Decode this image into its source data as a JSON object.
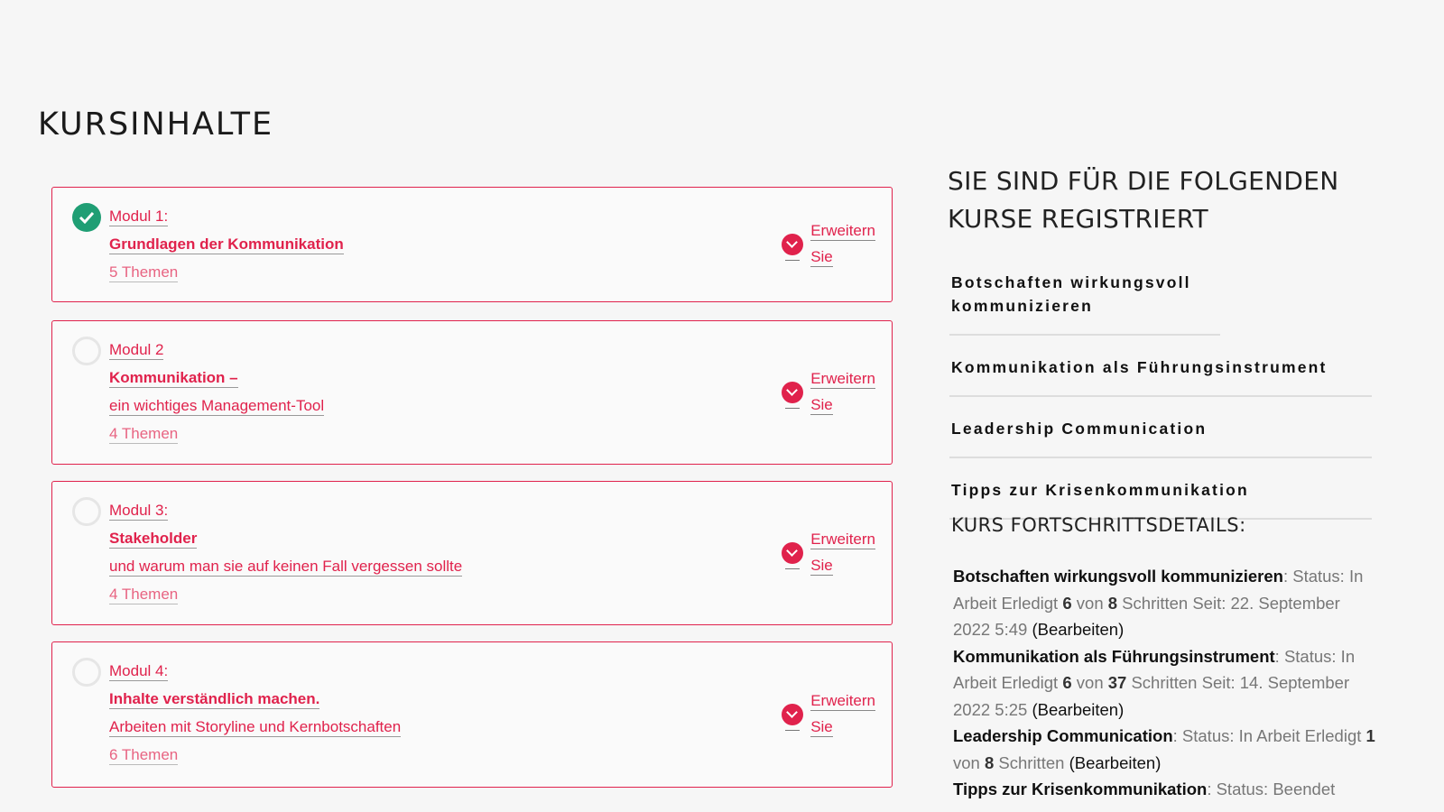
{
  "page_title": "KURSINHALTE",
  "modules": [
    {
      "status": "completed",
      "lines": [
        "Modul 1:",
        "Grundlagen der Kommunikation"
      ],
      "topics": "5 Themen",
      "expand_line1": "Erweitern",
      "expand_line2": "Sie"
    },
    {
      "status": "open",
      "lines": [
        "Modul 2",
        "Kommunikation –",
        "ein wichtiges Management-Tool"
      ],
      "topics": "4 Themen",
      "expand_line1": "Erweitern",
      "expand_line2": "Sie"
    },
    {
      "status": "open",
      "lines": [
        "Modul 3:",
        "Stakeholder",
        "und warum man sie auf keinen Fall vergessen sollte"
      ],
      "topics": "4 Themen",
      "expand_line1": "Erweitern",
      "expand_line2": "Sie"
    },
    {
      "status": "open",
      "lines": [
        "Modul 4:",
        "Inhalte verständlich machen.",
        "Arbeiten mit Storyline und Kernbotschaften"
      ],
      "topics": "6 Themen",
      "expand_line1": "Erweitern",
      "expand_line2": "Sie"
    }
  ],
  "sidebar": {
    "title_line1": "SIE SIND FÜR DIE FOLGENDEN",
    "title_line2": "KURSE REGISTRIERT",
    "courses": [
      "Botschaften wirkungsvoll kommunizieren",
      "Kommunikation als Führungsinstrument",
      "Leadership Communication",
      "Tipps zur Krisenkommunikation"
    ],
    "progress_title": "KURS FORTSCHRITTSDETAILS:",
    "progress": [
      {
        "course": "Botschaften wirkungsvoll kommunizieren",
        "status_label": ": Status: In Arbeit Erledigt ",
        "done": "6",
        "of": " von ",
        "total": "8",
        "steps_text": " Schritten Seit: 22. September 2022 5:49 ",
        "edit": "(Bearbeiten)"
      },
      {
        "course": "Kommunikation als Führungsinstrument",
        "status_label": ": Status: In Arbeit Erledigt ",
        "done": "6",
        "of": " von ",
        "total": "37",
        "steps_text": " Schritten Seit: 14. September 2022 5:25 ",
        "edit": "(Bearbeiten)"
      },
      {
        "course": "Leadership Communication",
        "status_label": ": Status: In Arbeit Erledigt ",
        "done": "1",
        "of": " von ",
        "total": "8",
        "steps_text": " Schritten ",
        "edit": "(Bearbeiten)"
      },
      {
        "course": "Tipps zur Krisenkommunikation",
        "status_label": ": Status: Beendet",
        "done": "",
        "of": "",
        "total": "",
        "steps_text": "",
        "edit": ""
      }
    ]
  },
  "colors": {
    "accent": "#e0224c",
    "completed": "#1f9e74",
    "background": "#f6f6f6"
  },
  "icons": {
    "completed": "check-circle-icon",
    "open": "empty-circle-icon",
    "expand": "chevron-down-circle-icon"
  }
}
